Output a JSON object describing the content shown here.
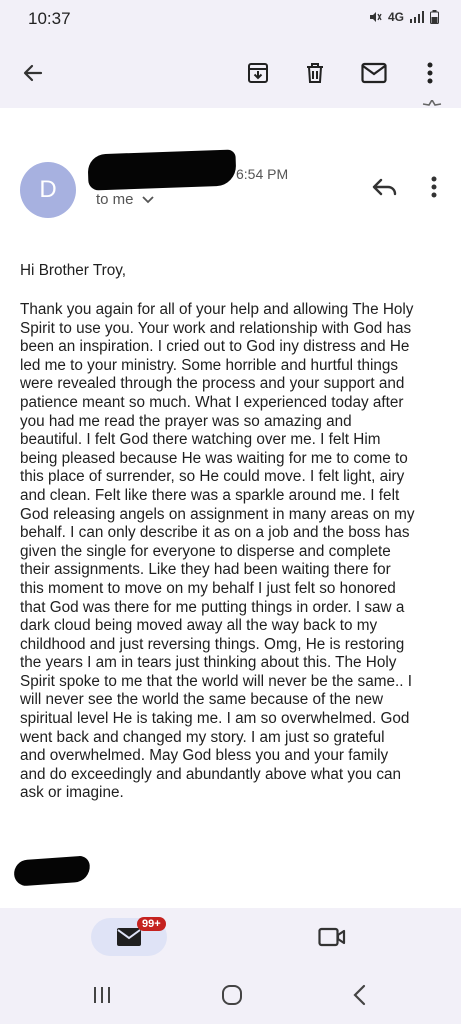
{
  "status": {
    "time": "10:37",
    "network": "4G"
  },
  "email": {
    "avatar_initial": "D",
    "sender": "",
    "time": "6:54 PM",
    "recipient_label": "to me",
    "greeting": "Hi Brother Troy,",
    "body": "Thank you again for all of your help and allowing The Holy\nSpirit to use you. Your work and relationship with God has\nbeen an inspiration. I cried out to God iny distress and He\nled me to your ministry. Some horrible and hurtful things\nwere revealed through the process and your support and\npatience meant so much. What I experienced today after\nyou had me read the prayer was so amazing and\nbeautiful. I felt God there watching over me. I felt Him\nbeing pleased because He was waiting for me to come to\nthis place of surrender, so He could move. I felt light, airy\nand clean. Felt like there was a sparkle around me. I felt\nGod releasing angels on assignment in many areas on my\nbehalf. I can only describe it as on a job and the boss has\ngiven the single for everyone to disperse and complete\ntheir assignments. Like they had been waiting there for\nthis moment to move on my behalf I just felt so honored\nthat God was there for me putting things in order. I saw a\ndark cloud being moved away all the way back  to my\nchildhood  and just reversing things. Omg, He is restoring\nthe years  I am in tears just thinking about this. The Holy\nSpirit spoke to me that the world will never be the same.. I\nwill never see the world the same because of the new\nspiritual level He is taking me. I am so overwhelmed. God\nwent back and changed my story. I am just so grateful\nand overwhelmed. May God bless you and your family\nand do exceedingly and abundantly above what you can\nask or imagine."
  },
  "bottom_nav": {
    "mail_badge": "99+"
  },
  "icons": {
    "back": "arrow-left-icon",
    "archive": "archive-icon",
    "delete": "trash-icon",
    "mark_unread": "mail-icon",
    "more": "more-vert-icon",
    "reply": "reply-icon",
    "mail_tab": "mail-icon",
    "meet_tab": "video-icon"
  },
  "colors": {
    "app_bar_bg": "#f2f0f8",
    "avatar_bg": "#a7b1e0",
    "badge_bg": "#c5221f"
  }
}
